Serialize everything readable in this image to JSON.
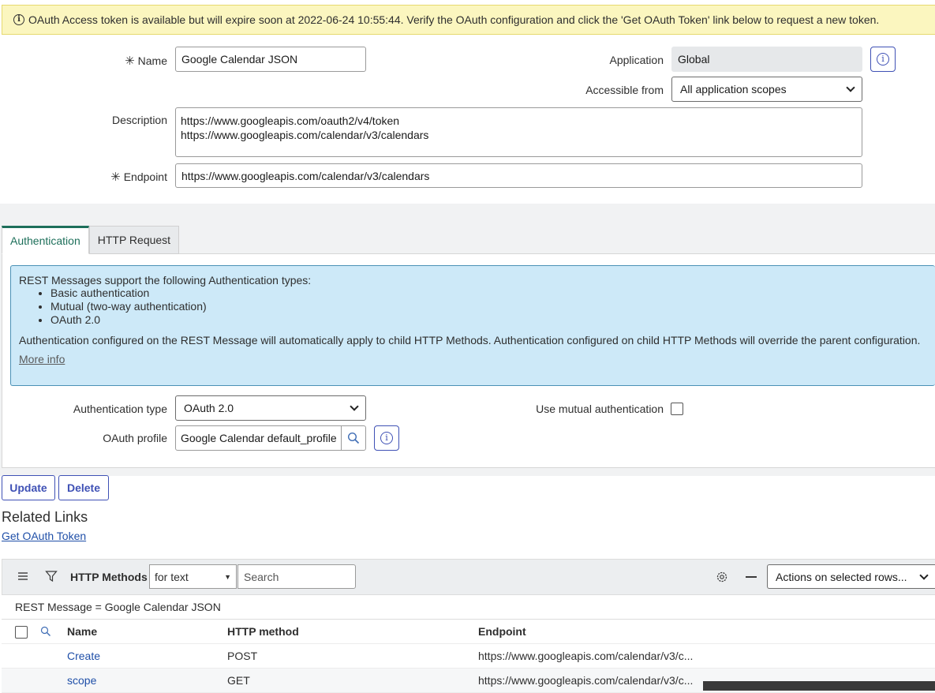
{
  "banner": {
    "icon": "info-icon",
    "text": "OAuth Access token is available but will expire soon at 2022-06-24 10:55:44. Verify the OAuth configuration and click the 'Get OAuth Token' link below to request a new token."
  },
  "form": {
    "name_label": "Name",
    "name_value": "Google Calendar JSON",
    "application_label": "Application",
    "application_value": "Global",
    "accessible_label": "Accessible from",
    "accessible_value": "All application scopes",
    "description_label": "Description",
    "description_lines": [
      "https://www.googleapis.com/oauth2/v4/token",
      "https://www.googleapis.com/calendar/v3/calendars"
    ],
    "endpoint_label": "Endpoint",
    "endpoint_value": "https://www.googleapis.com/calendar/v3/calendars",
    "required_mark": "✳"
  },
  "tabs": [
    {
      "label": "Authentication",
      "active": true
    },
    {
      "label": "HTTP Request",
      "active": false
    }
  ],
  "auth": {
    "info_intro": "REST Messages support the following Authentication types:",
    "info_items": [
      "Basic authentication",
      "Mutual (two-way authentication)",
      "OAuth 2.0"
    ],
    "info_text": "Authentication configured on the REST Message will automatically apply to child HTTP Methods. Authentication configured on child HTTP Methods will override the parent configuration.",
    "more_info": "More info",
    "type_label": "Authentication type",
    "type_value": "OAuth 2.0",
    "mutual_label": "Use mutual authentication",
    "profile_label": "OAuth profile",
    "profile_value": "Google Calendar default_profile"
  },
  "actions": {
    "update": "Update",
    "delete": "Delete"
  },
  "related": {
    "title": "Related Links",
    "get_token": "Get OAuth Token"
  },
  "http_methods": {
    "title": "HTTP Methods",
    "search_field": "for text",
    "search_placeholder": "Search",
    "actions_select": "Actions on selected rows...",
    "filter": "REST Message = Google Calendar JSON",
    "columns": [
      "Name",
      "HTTP method",
      "Endpoint"
    ],
    "rows": [
      {
        "name": "Create",
        "method": "POST",
        "endpoint": "https://www.googleapis.com/calendar/v3/c..."
      },
      {
        "name": "scope",
        "method": "GET",
        "endpoint": "https://www.googleapis.com/calendar/v3/c..."
      }
    ]
  }
}
